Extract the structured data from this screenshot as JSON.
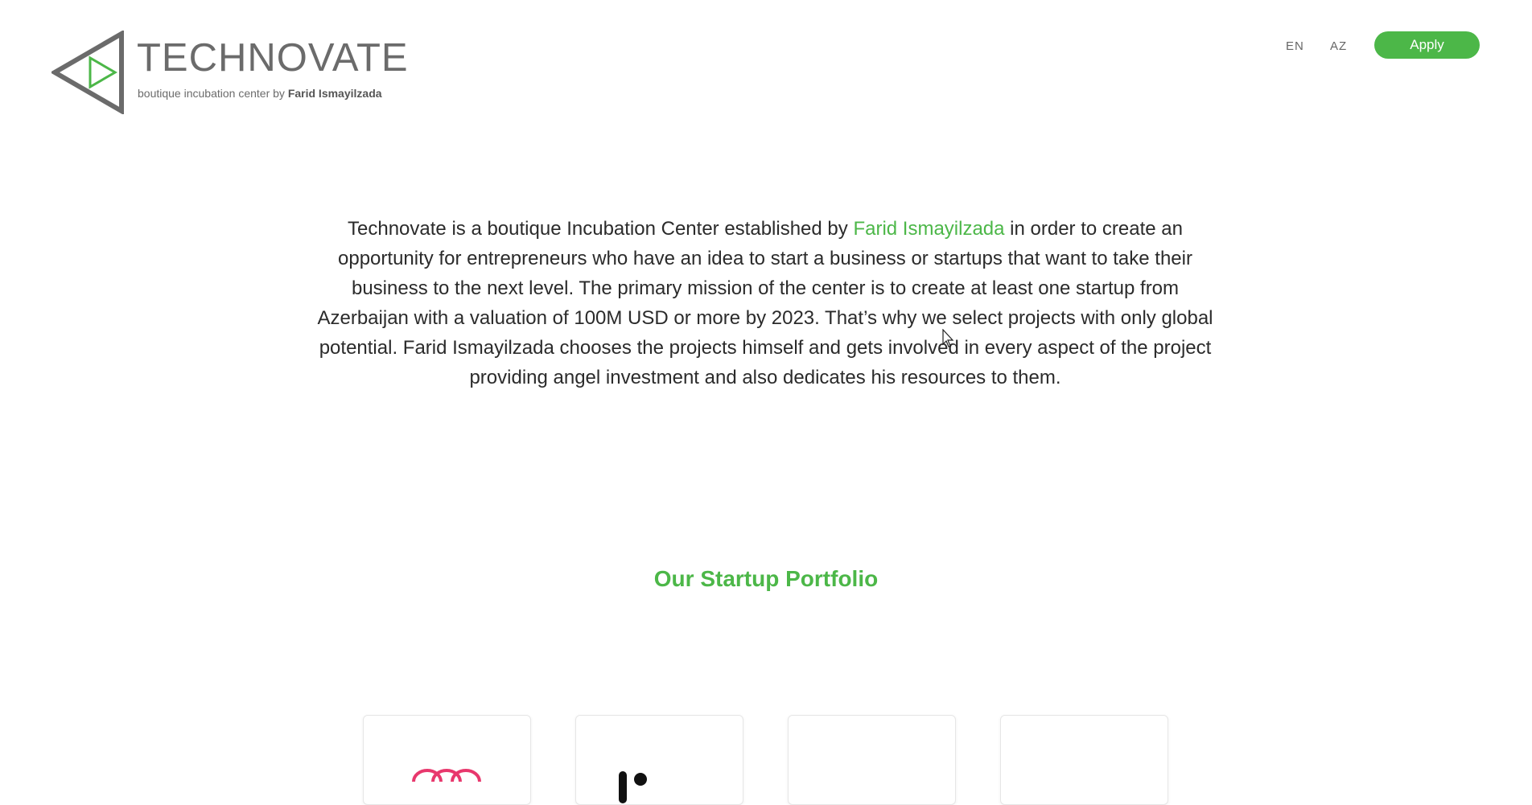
{
  "header": {
    "brand_name": "TECHNOVATE",
    "tagline_prefix": "boutique incubation center by ",
    "tagline_name": "Farid Ismayilzada",
    "languages": [
      "EN",
      "AZ"
    ],
    "apply_label": "Apply"
  },
  "intro": {
    "part1": "Technovate is a boutique Incubation Center established by ",
    "highlight": "Farid Ismayilzada",
    "part2": " in order to create an opportunity for entrepreneurs who have an idea to start a business or startups that want to take their business to the next level. The primary mission of the center is to create at least one startup from Azerbaijan with a valuation of 100M USD or more by 2023. That’s why we select projects with only global potential. Farid Ismayilzada chooses the projects himself and gets involved in every aspect of the project providing angel investment and also dedicates his resources to them."
  },
  "portfolio": {
    "title": "Our Startup Portfolio"
  },
  "colors": {
    "accent": "#4cb748",
    "text": "#2b2b2b",
    "logo_gray": "#6b6b6b",
    "card1_logo": "#e8386d"
  },
  "icons": {
    "logo": "triangle-play-icon",
    "cursor": "mouse-pointer-icon"
  }
}
